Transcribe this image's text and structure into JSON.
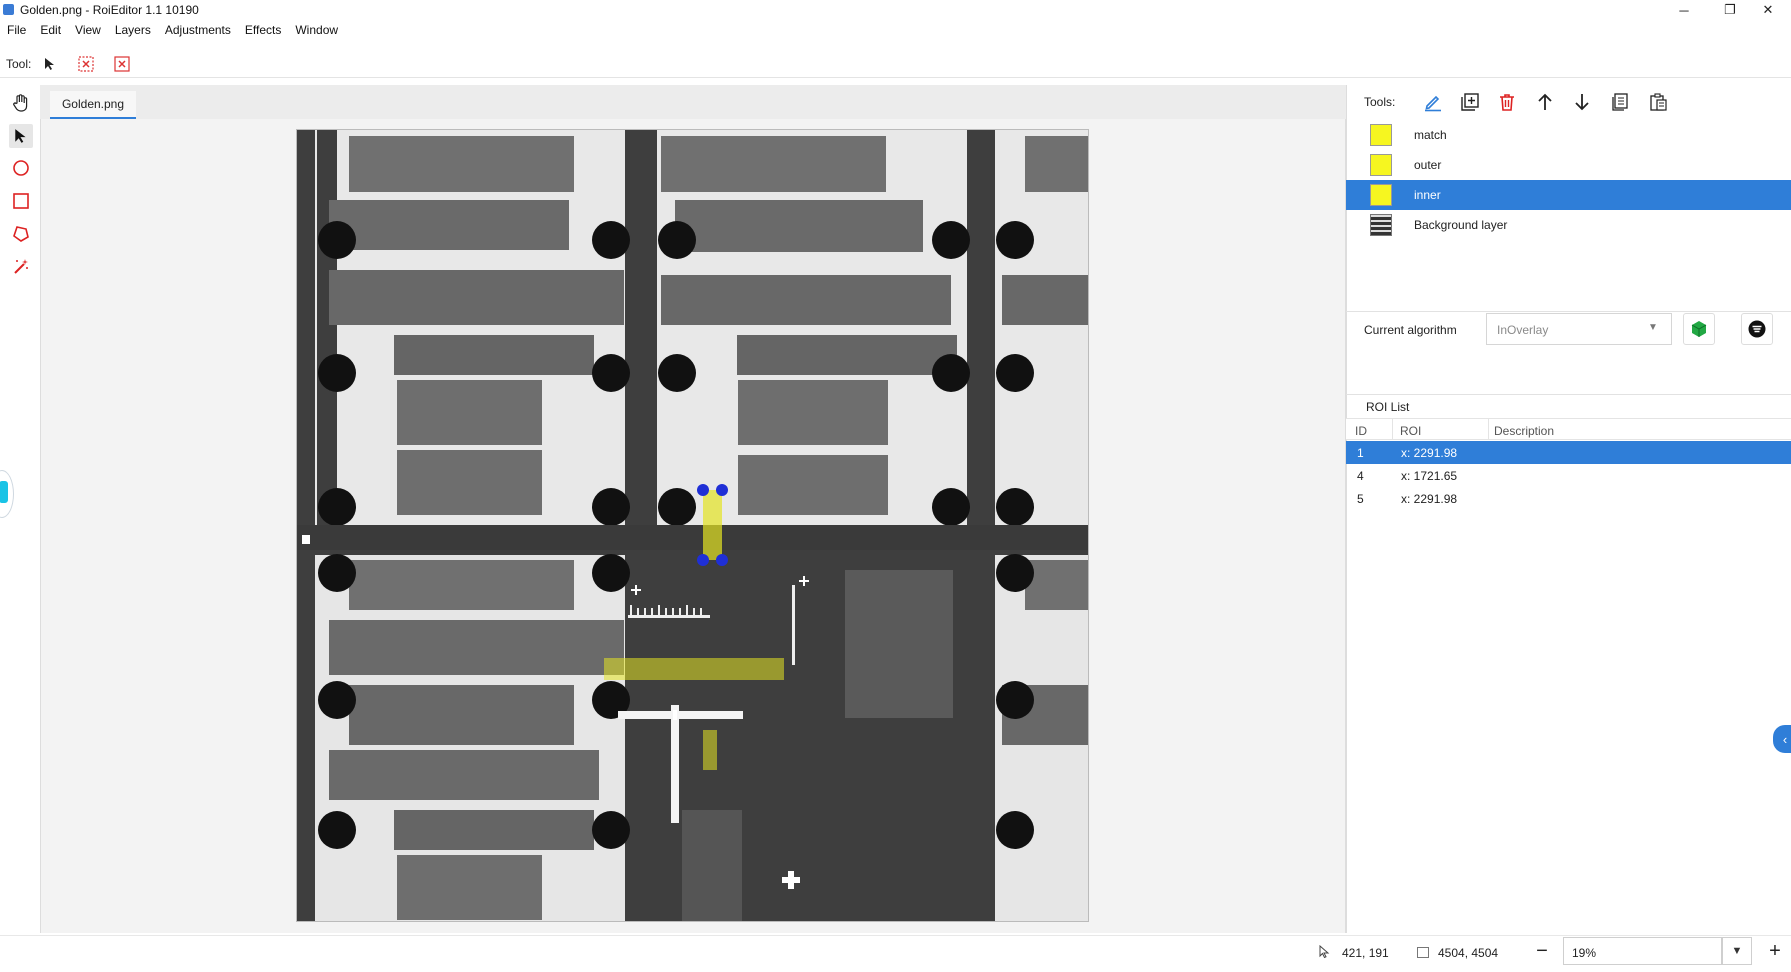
{
  "window": {
    "title": "Golden.png - RoiEditor 1.1 10190",
    "minimize": "─",
    "restore": "❐",
    "close": "✕"
  },
  "menu": [
    "File",
    "Edit",
    "View",
    "Layers",
    "Adjustments",
    "Effects",
    "Window"
  ],
  "toolbar": {
    "tool_label": "Tool:",
    "icons": [
      "arrow-cursor-icon",
      "clear-selection-icon",
      "clear-all-icon"
    ]
  },
  "left_tools": [
    "hand-icon",
    "pointer-icon",
    "ellipse-icon",
    "rectangle-icon",
    "polygon-icon",
    "magic-wand-icon"
  ],
  "document": {
    "tab": "Golden.png"
  },
  "right_panel": {
    "tools_label": "Tools:",
    "tool_icons": [
      "edit-pen-icon",
      "add-layer-icon",
      "delete-icon",
      "move-up-icon",
      "move-down-icon",
      "copy-icon",
      "paste-icon"
    ],
    "layers": [
      {
        "name": "match",
        "selected": false,
        "color": "#f6f620"
      },
      {
        "name": "outer",
        "selected": false,
        "color": "#f6f620"
      },
      {
        "name": "inner",
        "selected": true,
        "color": "#f6f620"
      },
      {
        "name": "Background layer",
        "selected": false,
        "color": "#333333"
      }
    ],
    "algorithm": {
      "label": "Current algorithm",
      "value": "InOverlay"
    },
    "roi_list": {
      "title": "ROI List",
      "columns": [
        "ID",
        "ROI",
        "Description"
      ],
      "rows": [
        {
          "id": "1",
          "roi": "x: 2291.98",
          "description": "",
          "selected": true
        },
        {
          "id": "4",
          "roi": "x: 1721.65",
          "description": "",
          "selected": false
        },
        {
          "id": "5",
          "roi": "x: 2291.98",
          "description": "",
          "selected": false
        }
      ]
    }
  },
  "status": {
    "cursor": "421, 191",
    "image_size": "4504, 4504",
    "zoom": "19%",
    "zoom_out": "−",
    "zoom_in": "+"
  },
  "colors": {
    "accent": "#2f7ed8",
    "roi_yellow": "#f6f620",
    "handle_blue": "#1f2fd6"
  }
}
